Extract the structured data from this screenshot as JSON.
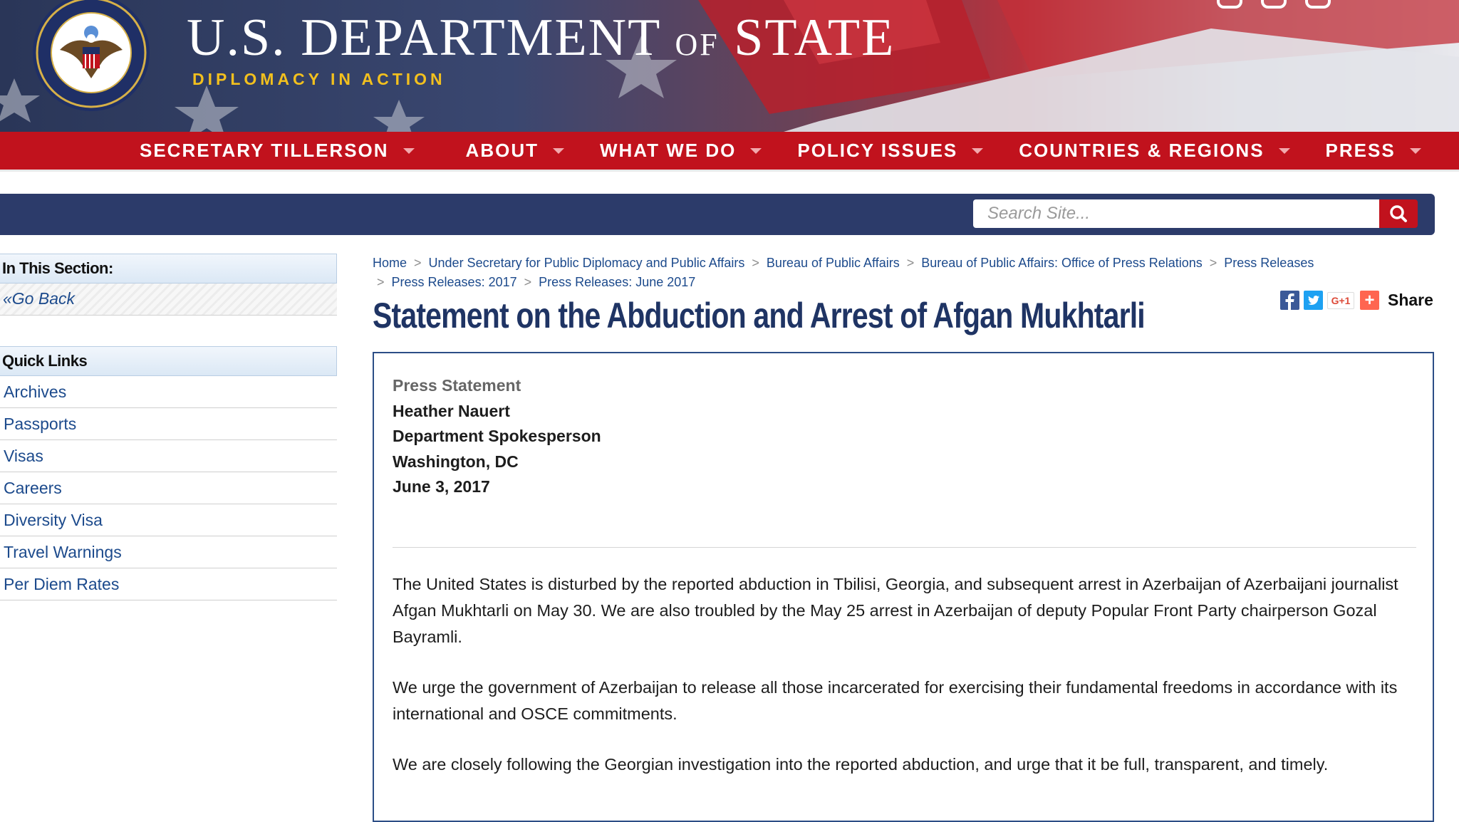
{
  "header": {
    "site_title_main": "U.S. DEPARTMENT",
    "site_title_of": "OF",
    "site_title_end": "STATE",
    "tagline": "DIPLOMACY IN ACTION",
    "colors": {
      "nav_red": "#c1121d",
      "navy": "#2c3b6a",
      "gold": "#f2c01e",
      "link_blue": "#1c4a8c",
      "title_navy": "#1f3464"
    }
  },
  "nav": {
    "items": [
      {
        "label": "SECRETARY TILLERSON"
      },
      {
        "label": "ABOUT"
      },
      {
        "label": "WHAT WE DO"
      },
      {
        "label": "POLICY ISSUES"
      },
      {
        "label": "COUNTRIES & REGIONS"
      },
      {
        "label": "PRESS"
      }
    ]
  },
  "search": {
    "placeholder": "Search Site...",
    "button_icon": "search-icon"
  },
  "sidebar": {
    "section_header": "In This Section:",
    "go_back": "Go Back",
    "go_back_icon": "double-chevron-left-icon",
    "quick_links_header": "Quick Links",
    "links": [
      {
        "label": "Archives"
      },
      {
        "label": "Passports"
      },
      {
        "label": "Visas"
      },
      {
        "label": "Careers"
      },
      {
        "label": "Diversity Visa"
      },
      {
        "label": "Travel Warnings"
      },
      {
        "label": "Per Diem Rates"
      }
    ]
  },
  "breadcrumb": {
    "items": [
      "Home",
      "Under Secretary for Public Diplomacy and Public Affairs",
      "Bureau of Public Affairs",
      "Bureau of Public Affairs: Office of Press Relations",
      "Press Releases",
      "Press Releases: 2017",
      "Press Releases: June 2017"
    ],
    "separator": ">"
  },
  "article": {
    "title": "Statement on the Abduction and Arrest of Afgan Mukhtarli",
    "share_label": "Share",
    "share_icons": [
      "facebook-icon",
      "twitter-icon",
      "google-plus-icon",
      "add-share-icon"
    ],
    "gplus_text": "G+1",
    "plus_text": "+",
    "meta": {
      "type": "Press Statement",
      "name": "Heather Nauert",
      "role": "Department Spokesperson",
      "location": "Washington, DC",
      "date": "June 3, 2017"
    },
    "paragraphs": [
      "The United States is disturbed by the reported abduction in Tbilisi, Georgia, and subsequent arrest in Azerbaijan of Azerbaijani journalist Afgan Mukhtarli on May 30. We are also troubled by the May 25 arrest in Azerbaijan of deputy Popular Front Party chairperson Gozal Bayramli.",
      "We urge the government of Azerbaijan to release all those incarcerated for exercising their fundamental freedoms in accordance with its international and OSCE commitments.",
      "We are closely following the Georgian investigation into the reported abduction, and urge that it be full, transparent, and timely."
    ]
  }
}
